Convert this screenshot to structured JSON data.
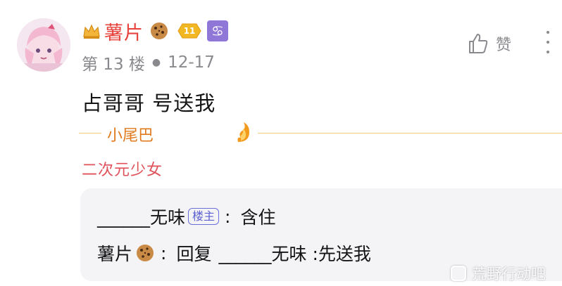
{
  "post": {
    "username": "薯片",
    "level": "11",
    "zodiac_symbol": "♋",
    "floor": "第 13 楼",
    "date": "12-17",
    "content": "占哥哥 号送我",
    "tail_label": "小尾巴",
    "signature": "二次元少女"
  },
  "actions": {
    "like_label": "赞"
  },
  "replies": [
    {
      "author": "______无味",
      "badge": "楼主",
      "text": "含住"
    },
    {
      "author": "薯片",
      "prefix": "回复",
      "target": "______无味",
      "text": ":先送我"
    }
  ],
  "watermark": {
    "text": "荒野行动吧"
  },
  "colors": {
    "username": "#e8433c",
    "meta": "#8a8a8e",
    "tail": "#e07a1c",
    "signature": "#e0525b",
    "op_badge": "#5c60d0",
    "reply_bg": "#f4f4f7"
  }
}
